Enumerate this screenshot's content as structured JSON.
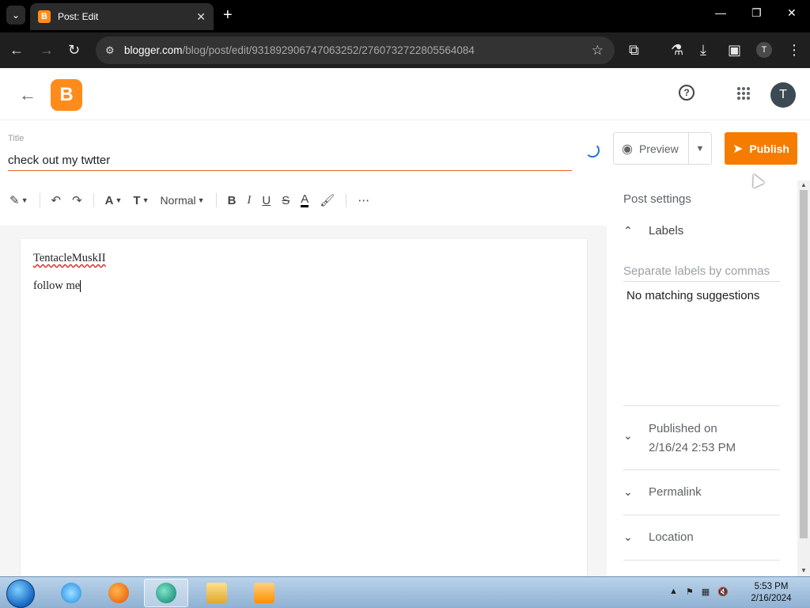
{
  "browser": {
    "tab_title": "Post: Edit",
    "url_host": "blogger.com",
    "url_path": "/blog/post/edit/931892906747063252/2760732722805564084",
    "profile_initial": "T"
  },
  "header": {
    "account_initial": "T",
    "help_glyph": "?"
  },
  "post": {
    "title_label": "Title",
    "title_value": "check out my twtter",
    "body_lines": [
      "TentacleMuskII",
      "follow me"
    ]
  },
  "actions": {
    "preview_label": "Preview",
    "publish_label": "Publish"
  },
  "format_toolbar": {
    "paragraph_style": "Normal"
  },
  "sidebar": {
    "heading": "Post settings",
    "labels_title": "Labels",
    "labels_placeholder": "Separate labels by commas",
    "no_suggestions": "No matching suggestions",
    "published_label": "Published on",
    "published_date": "2/16/24 2:53 PM",
    "permalink_label": "Permalink",
    "location_label": "Location"
  },
  "taskbar": {
    "time": "5:53 PM",
    "date": "2/16/2024"
  },
  "colors": {
    "brand": "#ff8c1a",
    "publish": "#f57c00",
    "title_underline": "#e8642c"
  }
}
